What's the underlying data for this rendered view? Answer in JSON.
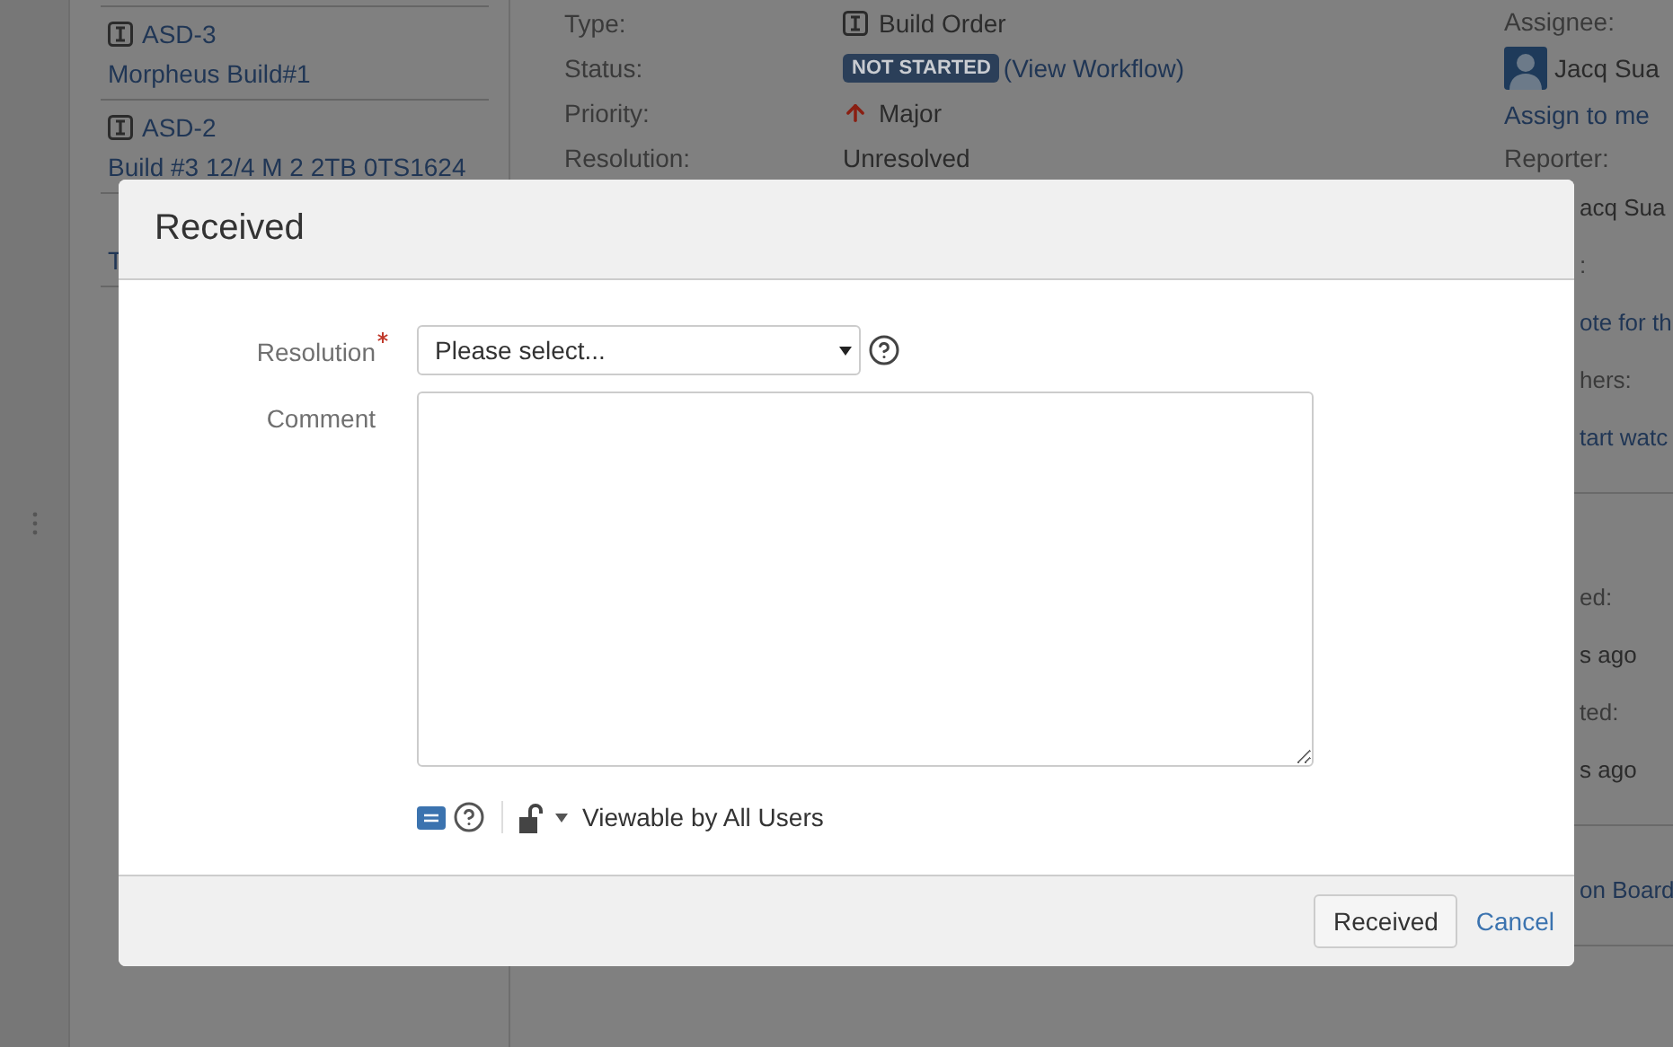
{
  "sidebar": {
    "items": [
      {
        "key": "ASD-3",
        "summary": "Morpheus Build#1"
      },
      {
        "key": "ASD-2",
        "summary": "Build #3 12/4 M 2 2TB 0TS1624"
      },
      {
        "summary": "T"
      }
    ]
  },
  "details": [
    {
      "kind": "type",
      "label": "Type:",
      "value": "Build Order"
    },
    {
      "kind": "status",
      "label": "Status:",
      "value": "NOT STARTED",
      "link": "(View Workflow)"
    },
    {
      "kind": "priority",
      "label": "Priority:",
      "value": "Major"
    },
    {
      "kind": "text",
      "label": "Resolution:",
      "value": "Unresolved"
    }
  ],
  "people": {
    "sections": [
      {
        "items": [
          {
            "kind": "label",
            "text": "Assignee:"
          },
          {
            "kind": "user",
            "text": "Jacq Sua"
          },
          {
            "kind": "link",
            "text": "Assign to me"
          },
          {
            "kind": "label",
            "text": "Reporter:"
          },
          {
            "kind": "covered-text",
            "text": "acq Sua"
          },
          {
            "kind": "covered-label",
            "text": ":"
          },
          {
            "kind": "covered-link",
            "text": "ote for th"
          },
          {
            "kind": "covered-label",
            "text": "hers:"
          },
          {
            "kind": "covered-link",
            "text": "tart watc"
          }
        ]
      },
      {
        "items": [
          {
            "kind": "covered-label",
            "text": "ed:"
          },
          {
            "kind": "covered-text",
            "text": "s ago"
          },
          {
            "kind": "covered-label",
            "text": "ted:"
          },
          {
            "kind": "covered-text",
            "text": "s ago"
          }
        ]
      },
      {
        "items": [
          {
            "kind": "covered-link",
            "text": "on Board"
          }
        ]
      }
    ]
  },
  "dialog": {
    "title": "Received",
    "fields": [
      {
        "kind": "select",
        "label": "Resolution",
        "required": true,
        "placeholder": "Please select..."
      },
      {
        "kind": "textarea",
        "label": "Comment",
        "required": false
      }
    ],
    "visibility": "Viewable by All Users",
    "buttons": [
      {
        "kind": "button",
        "label": "Received"
      },
      {
        "kind": "link",
        "label": "Cancel"
      }
    ]
  }
}
